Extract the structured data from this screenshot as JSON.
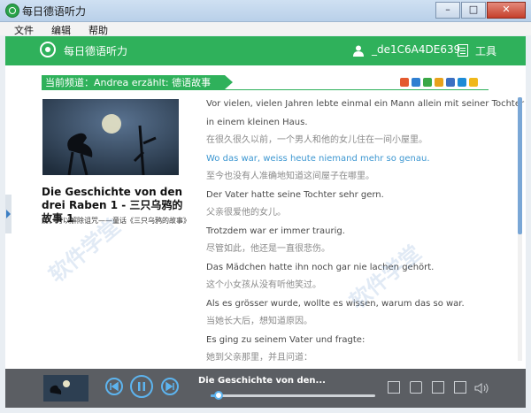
{
  "window": {
    "title": "每日德语听力"
  },
  "menu": {
    "file": "文件",
    "edit": "编辑",
    "help": "帮助"
  },
  "header": {
    "app_name": "每日德语听力",
    "username": "_de1C6A4DE639",
    "tools": "工具"
  },
  "channel": {
    "label": "当前频道：Andrea erzählt: 德语故事"
  },
  "share_colors": [
    "#e45a2f",
    "#2f7fd1",
    "#3aa847",
    "#e8a21c",
    "#3b6fc2",
    "#1d8bd6",
    "#f0b81a"
  ],
  "story": {
    "title": "Die Geschichte von den drei Raben 1 - 三只乌鸦的故事 1",
    "subtitle": "爱，可以解除诅咒——童话《三只乌鸦的故事》"
  },
  "lines": [
    {
      "text": "Vor vielen, vielen Jahren lebte einmal ein Mann allein mit seiner Tochter",
      "type": "de"
    },
    {
      "text": "in einem kleinen Haus.",
      "type": "de"
    },
    {
      "text": "在很久很久以前，一个男人和他的女儿住在一间小屋里。",
      "type": "cn"
    },
    {
      "text": "Wo das war, weiss heute niemand mehr so genau.",
      "type": "active"
    },
    {
      "text": "至今也没有人准确地知道这间屋子在哪里。",
      "type": "cn"
    },
    {
      "text": "Der Vater hatte seine Tochter sehr gern.",
      "type": "de"
    },
    {
      "text": "父亲很爱他的女儿。",
      "type": "cn"
    },
    {
      "text": "Trotzdem war er immer traurig.",
      "type": "de"
    },
    {
      "text": "尽管如此，他还是一直很悲伤。",
      "type": "cn"
    },
    {
      "text": "Das Mädchen hatte ihn noch gar nie lachen gehört.",
      "type": "de"
    },
    {
      "text": "这个小女孩从没有听他笑过。",
      "type": "cn"
    },
    {
      "text": "Als es grösser wurde, wollte es wissen, warum das so war.",
      "type": "de"
    },
    {
      "text": "当她长大后，想知道原因。",
      "type": "cn"
    },
    {
      "text": "Es ging zu seinem Vater und fragte:",
      "type": "de"
    },
    {
      "text": "她到父亲那里，并且问道：",
      "type": "cn"
    }
  ],
  "player": {
    "track_title": "Die Geschichte von den...",
    "progress": 0.05
  },
  "colors": {
    "accent_green": "#2fb15b",
    "accent_blue": "#5db4ef",
    "player_bg": "#5b5e63"
  }
}
